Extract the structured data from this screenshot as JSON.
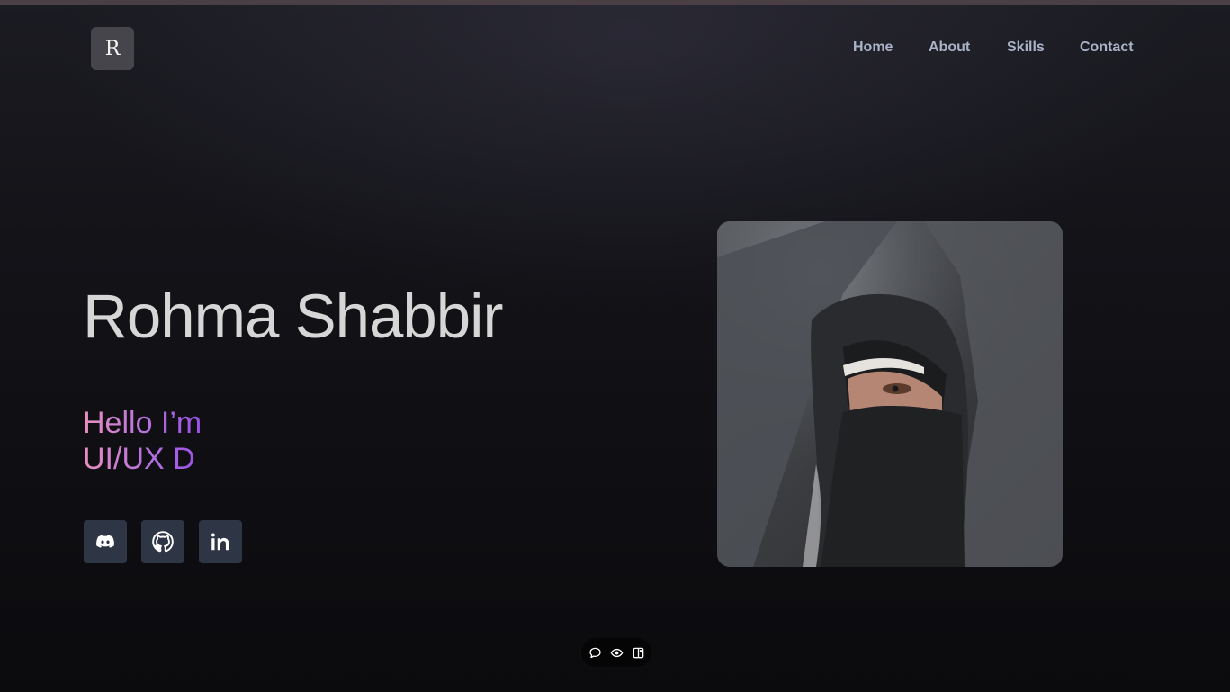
{
  "header": {
    "logo_letter": "R",
    "nav": {
      "home": "Home",
      "about": "About",
      "skills": "Skills",
      "contact": "Contact"
    }
  },
  "hero": {
    "name": "Rohma Shabbir",
    "greeting_line1": "Hello I’m",
    "greeting_line2": "UI/UX D"
  },
  "social": {
    "icons": [
      "discord-icon",
      "github-icon",
      "linkedin-icon"
    ]
  },
  "dock": {
    "icons": [
      "chat-icon",
      "eye-icon",
      "panel-icon"
    ]
  },
  "colors": {
    "accent_pink": "#e88fbe",
    "accent_purple": "#9b4fe8",
    "nav_text": "#a9b3c6",
    "social_button_bg": "#2e3544"
  }
}
